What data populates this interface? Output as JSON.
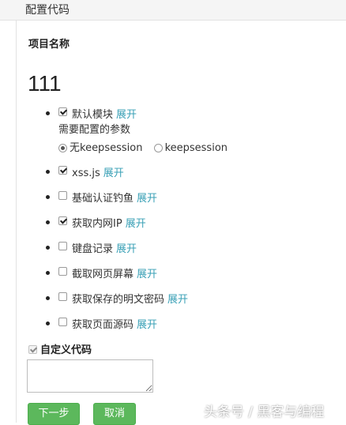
{
  "header": {
    "title": "配置代码"
  },
  "project": {
    "label": "项目名称",
    "name": "111"
  },
  "expand_label": "展开",
  "modules": [
    {
      "label": "默认模块",
      "checked": true
    },
    {
      "label": "xss.js",
      "checked": true
    },
    {
      "label": "基础认证钓鱼",
      "checked": false
    },
    {
      "label": "获取内网IP",
      "checked": true
    },
    {
      "label": "键盘记录",
      "checked": false
    },
    {
      "label": "截取网页屏幕",
      "checked": false
    },
    {
      "label": "获取保存的明文密码",
      "checked": false
    },
    {
      "label": "获取页面源码",
      "checked": false
    }
  ],
  "default_module_config": {
    "title": "需要配置的参数",
    "options": [
      {
        "label": "无keepsession",
        "selected": true
      },
      {
        "label": "keepsession",
        "selected": false
      }
    ]
  },
  "custom_code": {
    "label": "自定义代码",
    "checked": true,
    "value": ""
  },
  "buttons": {
    "next": "下一步",
    "cancel": "取消"
  },
  "watermark": "头条号 / 黑客与编程",
  "colors": {
    "link": "#39a0b6",
    "button": "#5cb85c",
    "header_bg": "#f5f5f5"
  }
}
